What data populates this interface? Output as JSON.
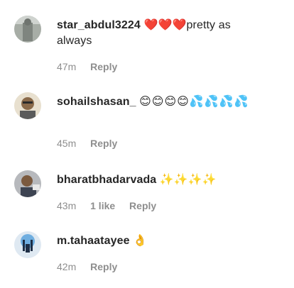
{
  "comments": [
    {
      "username": "star_abdul3224",
      "emoji": "❤️❤️❤️",
      "text": "pretty as always",
      "time": "47m",
      "likes": "",
      "reply": "Reply",
      "avatar_color": "#9aa19a"
    },
    {
      "username": "sohailshasan_",
      "emoji": "😊😊😊😊💦💦💦💦",
      "text": "",
      "time": "45m",
      "likes": "",
      "reply": "Reply",
      "avatar_color": "#d8c9a8"
    },
    {
      "username": "bharatbhadarvada",
      "emoji": "✨✨✨✨",
      "text": "",
      "time": "43m",
      "likes": "1 like",
      "reply": "Reply",
      "avatar_color": "#5a6270"
    },
    {
      "username": "m.tahaatayee",
      "emoji": "👌",
      "text": "",
      "time": "42m",
      "likes": "",
      "reply": "Reply",
      "avatar_color": "#7fb6e0"
    }
  ]
}
